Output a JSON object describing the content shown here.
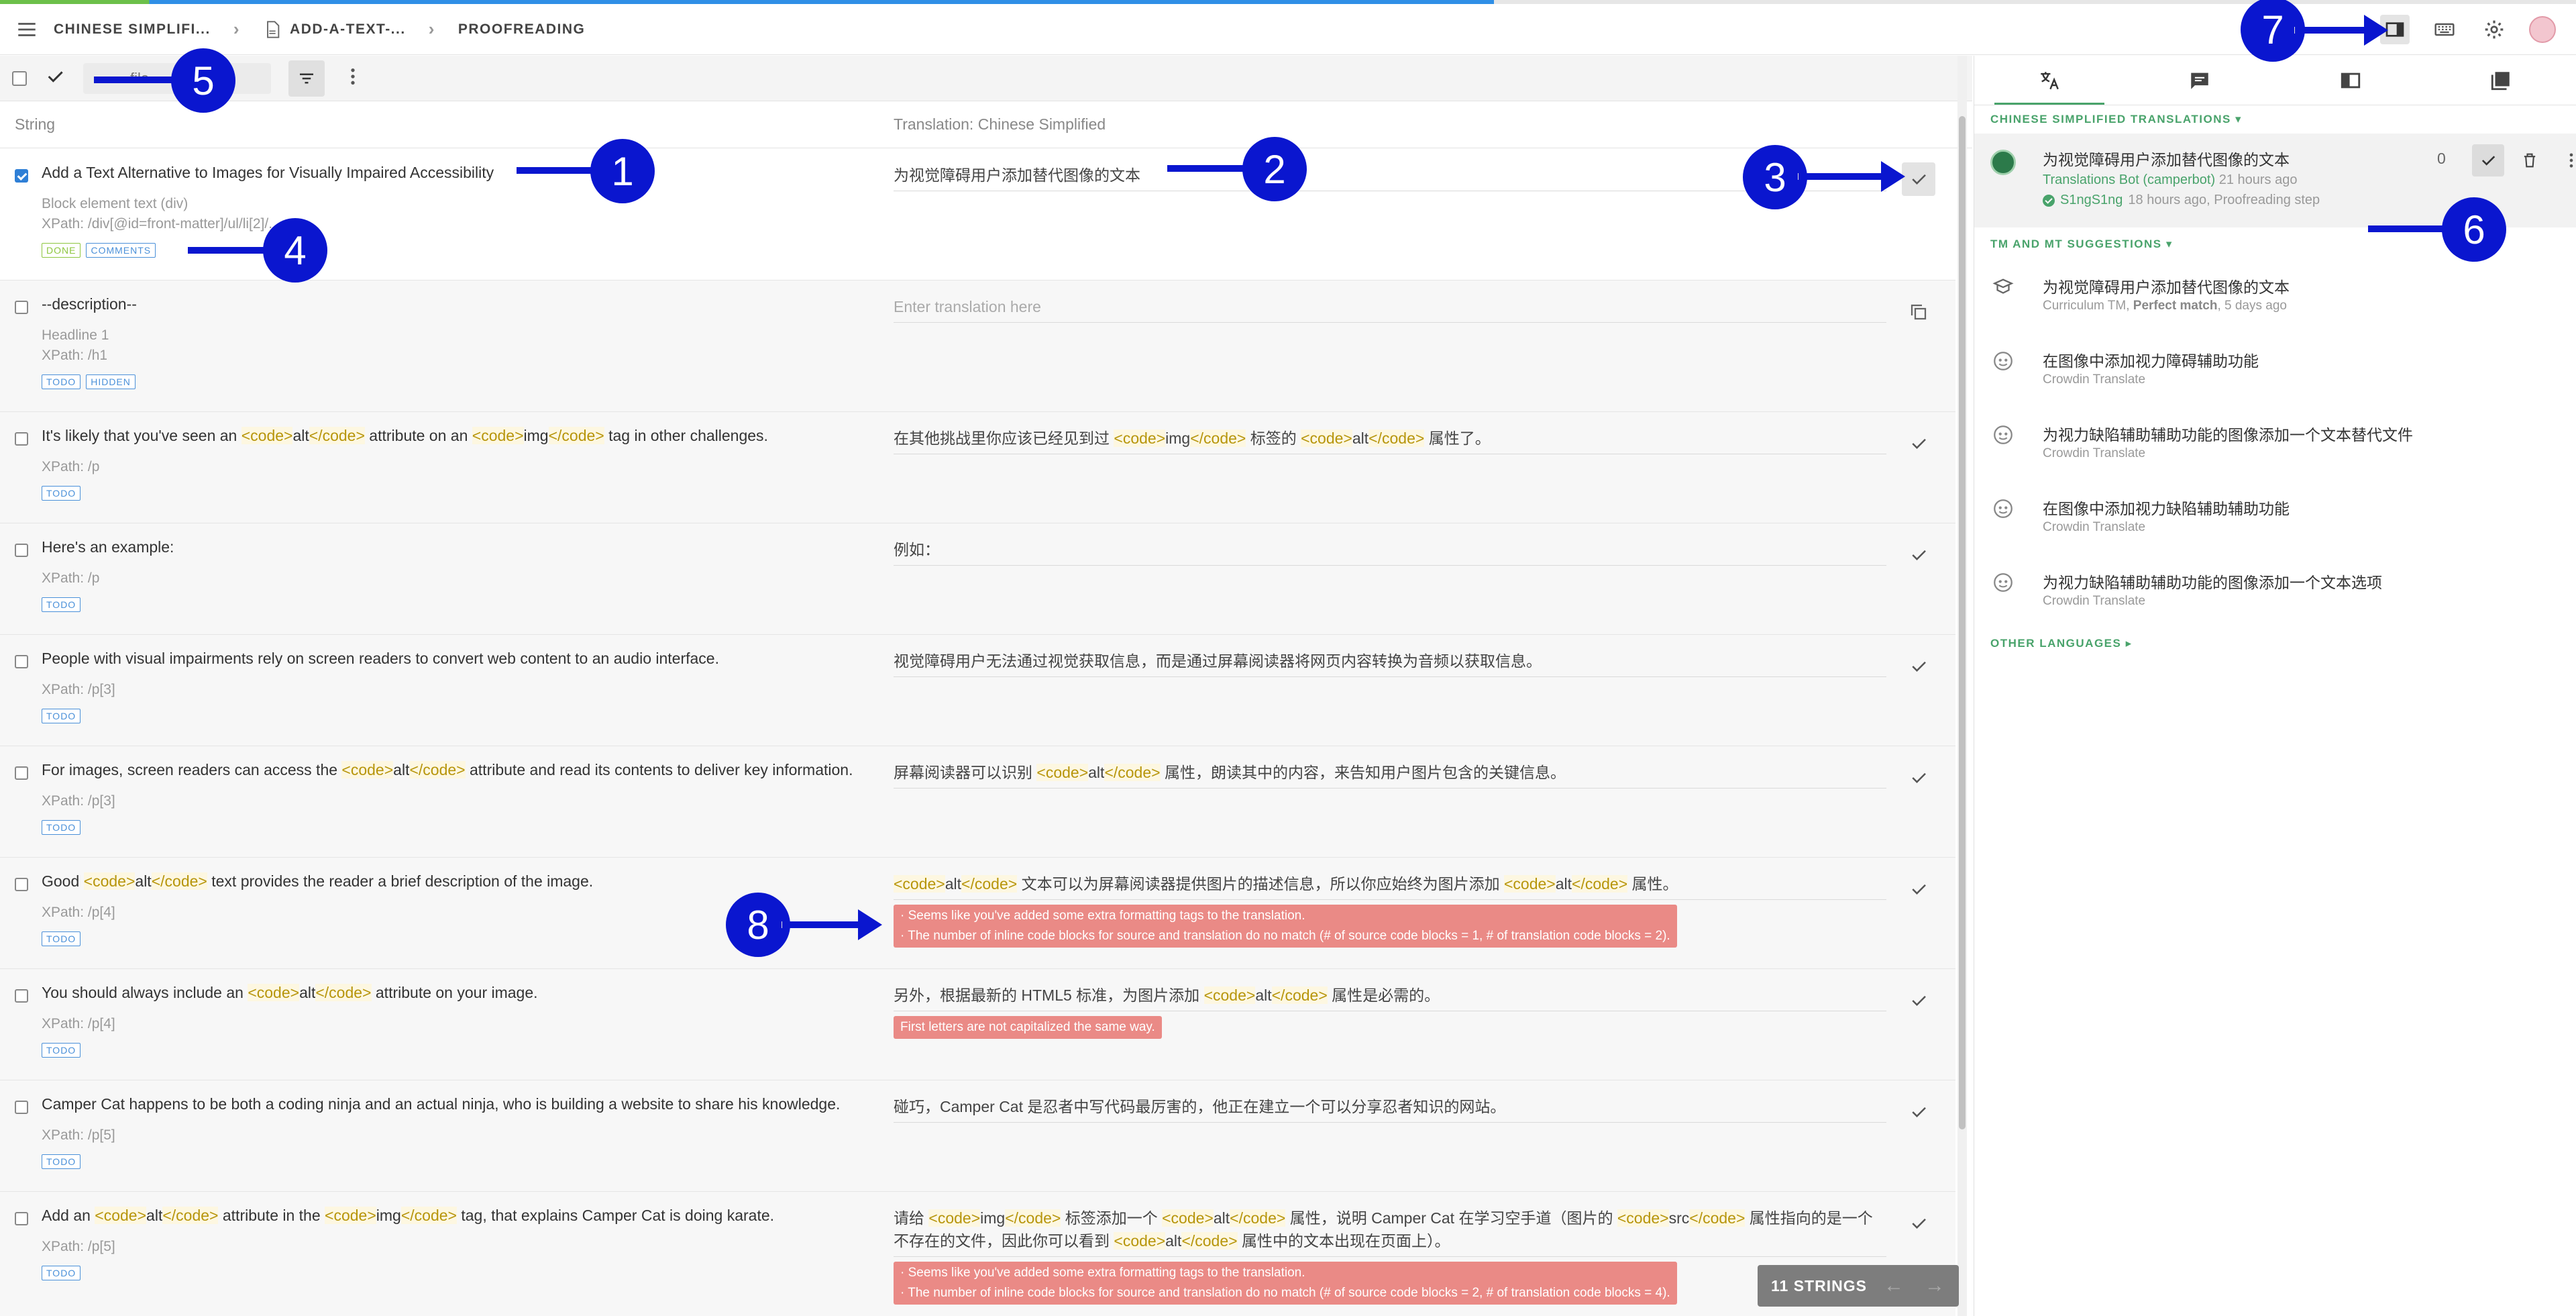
{
  "breadcrumb": {
    "project": "CHINESE SIMPLIFI...",
    "file": "ADD-A-TEXT-...",
    "step": "PROOFREADING"
  },
  "toolbar": {
    "search_placeholder": "file"
  },
  "columns": {
    "string": "String",
    "translation": "Translation: Chinese Simplified"
  },
  "rows": [
    {
      "source_parts": [
        {
          "t": "Add a Text Alternative to Images for Visually Impaired Accessibility"
        }
      ],
      "meta": [
        "Block element text (div)",
        "XPath: /div[@id=front-matter]/ul/li[2]/..."
      ],
      "tags": [
        "DONE",
        "COMMENTS"
      ],
      "translation_parts": [
        {
          "t": "为视觉障碍用户添加替代图像的文本"
        }
      ],
      "errors": [],
      "checked": true
    },
    {
      "source_parts": [
        {
          "t": "--description--"
        }
      ],
      "meta": [
        "Headline 1",
        "XPath: /h1"
      ],
      "tags": [
        "TODO",
        "HIDDEN"
      ],
      "translation_parts": [],
      "placeholder": "Enter translation here",
      "errors": []
    },
    {
      "source_parts": [
        {
          "t": "It's likely that you've seen an "
        },
        {
          "c": "<code>"
        },
        {
          "t": "alt"
        },
        {
          "c": "</code>"
        },
        {
          "t": " attribute on an "
        },
        {
          "c": "<code>"
        },
        {
          "t": "img"
        },
        {
          "c": "</code>"
        },
        {
          "t": " tag in other challenges."
        }
      ],
      "meta": [
        "XPath: /p"
      ],
      "tags": [
        "TODO"
      ],
      "translation_parts": [
        {
          "t": "在其他挑战里你应该已经见到过 "
        },
        {
          "c": "<code>"
        },
        {
          "t": "img"
        },
        {
          "c": "</code>"
        },
        {
          "t": " 标签的 "
        },
        {
          "c": "<code>"
        },
        {
          "t": "alt"
        },
        {
          "c": "</code>"
        },
        {
          "t": " 属性了。"
        }
      ],
      "errors": []
    },
    {
      "source_parts": [
        {
          "t": "Here's an example:"
        }
      ],
      "meta": [
        "XPath: /p"
      ],
      "tags": [
        "TODO"
      ],
      "translation_parts": [
        {
          "t": "例如："
        }
      ],
      "errors": []
    },
    {
      "source_parts": [
        {
          "t": "People with visual impairments rely on screen readers to convert web content to an audio interface."
        }
      ],
      "meta": [
        "XPath: /p[3]"
      ],
      "tags": [
        "TODO"
      ],
      "translation_parts": [
        {
          "t": "视觉障碍用户无法通过视觉获取信息，而是通过屏幕阅读器将网页内容转换为音频以获取信息。"
        }
      ],
      "errors": []
    },
    {
      "source_parts": [
        {
          "t": "For images, screen readers can access the "
        },
        {
          "c": "<code>"
        },
        {
          "t": "alt"
        },
        {
          "c": "</code>"
        },
        {
          "t": " attribute and read its contents to deliver key information."
        }
      ],
      "meta": [
        "XPath: /p[3]"
      ],
      "tags": [
        "TODO"
      ],
      "translation_parts": [
        {
          "t": "屏幕阅读器可以识别 "
        },
        {
          "c": "<code>"
        },
        {
          "t": "alt"
        },
        {
          "c": "</code>"
        },
        {
          "t": " 属性，朗读其中的内容，来告知用户图片包含的关键信息。"
        }
      ],
      "errors": []
    },
    {
      "source_parts": [
        {
          "t": "Good "
        },
        {
          "c": "<code>"
        },
        {
          "t": "alt"
        },
        {
          "c": "</code>"
        },
        {
          "t": " text provides the reader a brief description of the image."
        }
      ],
      "meta": [
        "XPath: /p[4]"
      ],
      "tags": [
        "TODO"
      ],
      "translation_parts": [
        {
          "c": "<code>"
        },
        {
          "t": "alt"
        },
        {
          "c": "</code>"
        },
        {
          "t": " 文本可以为屏幕阅读器提供图片的描述信息，所以你应始终为图片添加 "
        },
        {
          "c": "<code>"
        },
        {
          "t": "alt"
        },
        {
          "c": "</code>"
        },
        {
          "t": " 属性。"
        }
      ],
      "errors": [
        "· Seems like you've added some extra formatting tags to the translation.",
        "· The number of inline code blocks for source and translation do no match (# of source code blocks = 1, # of translation code blocks = 2)."
      ]
    },
    {
      "source_parts": [
        {
          "t": "You should always include an "
        },
        {
          "c": "<code>"
        },
        {
          "t": "alt"
        },
        {
          "c": "</code>"
        },
        {
          "t": " attribute on your image."
        }
      ],
      "meta": [
        "XPath: /p[4]"
      ],
      "tags": [
        "TODO"
      ],
      "translation_parts": [
        {
          "t": "另外，根据最新的 HTML5 标准，为图片添加 "
        },
        {
          "c": "<code>"
        },
        {
          "t": "alt"
        },
        {
          "c": "</code>"
        },
        {
          "t": " 属性是必需的。"
        }
      ],
      "errors": [
        "First letters are not capitalized the same way."
      ]
    },
    {
      "source_parts": [
        {
          "t": "Camper Cat happens to be both a coding ninja and an actual ninja, who is building a website to share his knowledge."
        }
      ],
      "meta": [
        "XPath: /p[5]"
      ],
      "tags": [
        "TODO"
      ],
      "translation_parts": [
        {
          "t": "碰巧，Camper Cat 是忍者中写代码最厉害的，他正在建立一个可以分享忍者知识的网站。"
        }
      ],
      "errors": []
    },
    {
      "source_parts": [
        {
          "t": "Add an "
        },
        {
          "c": "<code>"
        },
        {
          "t": "alt"
        },
        {
          "c": "</code>"
        },
        {
          "t": " attribute in the "
        },
        {
          "c": "<code>"
        },
        {
          "t": "img"
        },
        {
          "c": "</code>"
        },
        {
          "t": " tag, that explains Camper Cat is doing karate."
        }
      ],
      "meta": [
        "XPath: /p[5]"
      ],
      "tags": [
        "TODO"
      ],
      "translation_parts": [
        {
          "t": "请给 "
        },
        {
          "c": "<code>"
        },
        {
          "t": "img"
        },
        {
          "c": "</code>"
        },
        {
          "t": " 标签添加一个 "
        },
        {
          "c": "<code>"
        },
        {
          "t": "alt"
        },
        {
          "c": "</code>"
        },
        {
          "t": " 属性，说明 Camper Cat 在学习空手道（图片的 "
        },
        {
          "c": "<code>"
        },
        {
          "t": "src"
        },
        {
          "c": "</code>"
        },
        {
          "t": " 属性指向的是一个不存在的文件，因此你可以看到 "
        },
        {
          "c": "<code>"
        },
        {
          "t": "alt"
        },
        {
          "c": "</code>"
        },
        {
          "t": " 属性中的文本出现在页面上）。"
        }
      ],
      "errors": [
        "· Seems like you've added some extra formatting tags to the translation.",
        "· The number of inline code blocks for source and translation do no match (# of source code blocks = 2, # of translation code blocks = 4)."
      ]
    }
  ],
  "strings_count": "11 STRINGS",
  "right": {
    "translations_header": "CHINESE SIMPLIFIED TRANSLATIONS",
    "current": {
      "text": "为视觉障碍用户添加替代图像的文本",
      "author": "Translations Bot (camperbot)",
      "author_time": "21 hours ago",
      "approver": "S1ngS1ng",
      "approver_time": "18 hours ago, Proofreading step",
      "votes": "0"
    },
    "suggestions_header": "TM AND MT SUGGESTIONS",
    "suggestions": [
      {
        "text": "为视觉障碍用户添加替代图像的文本",
        "source": "Curriculum TM",
        "match": "Perfect match",
        "when": ", 5 days ago",
        "icon": "tm-icon"
      },
      {
        "text": "在图像中添加视力障碍辅助功能",
        "source": "Crowdin Translate",
        "icon": "crowdin-icon"
      },
      {
        "text": "为视力缺陷辅助辅助功能的图像添加一个文本替代文件",
        "source": "Crowdin Translate",
        "icon": "crowdin-icon"
      },
      {
        "text": "在图像中添加视力缺陷辅助辅助功能",
        "source": "Crowdin Translate",
        "icon": "crowdin-icon"
      },
      {
        "text": "为视力缺陷辅助辅助功能的图像添加一个文本选项",
        "source": "Crowdin Translate",
        "icon": "crowdin-icon"
      }
    ],
    "other_languages": "OTHER LANGUAGES"
  },
  "markers": [
    "1",
    "2",
    "3",
    "4",
    "5",
    "6",
    "7",
    "8"
  ],
  "colors": {
    "accent_green": "#49a36b",
    "marker_blue": "#0a16cf",
    "error_red": "#ea8a86",
    "code_yellow": "#b7950b"
  }
}
